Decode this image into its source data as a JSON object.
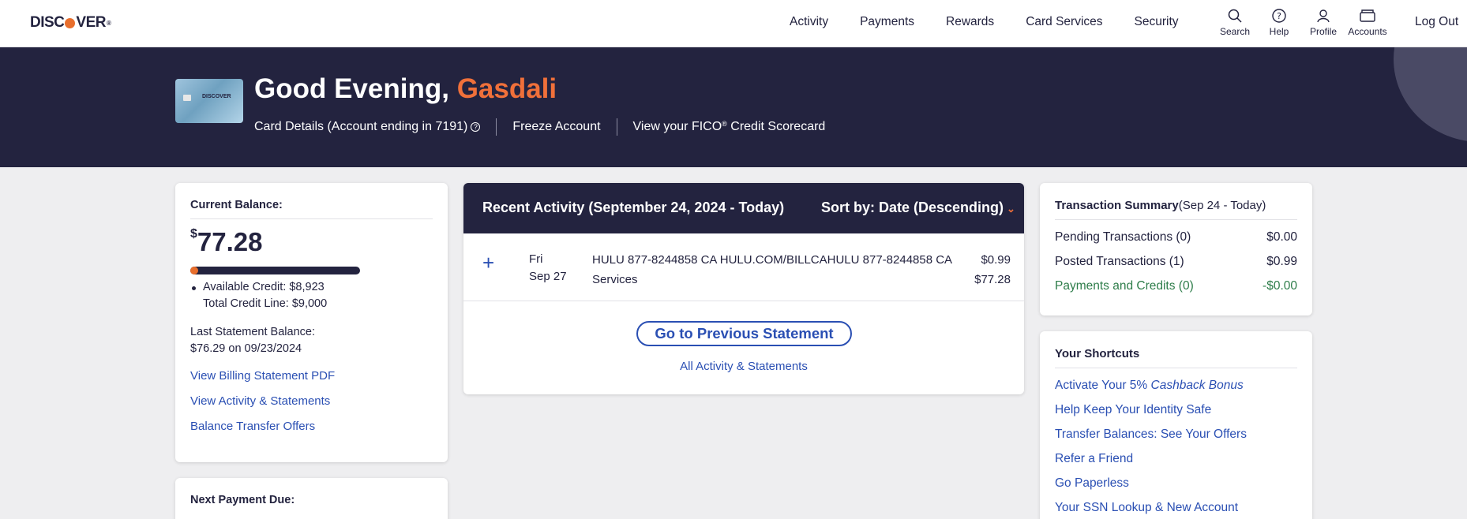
{
  "nav": {
    "logo": "DISCOVER",
    "links": [
      "Activity",
      "Payments",
      "Rewards",
      "Card Services",
      "Security"
    ],
    "icons": [
      {
        "label": "Search",
        "icon": "search-icon"
      },
      {
        "label": "Help",
        "icon": "help-icon"
      },
      {
        "label": "Profile",
        "icon": "profile-icon"
      },
      {
        "label": "Accounts",
        "icon": "accounts-icon"
      }
    ],
    "logout": "Log Out"
  },
  "banner": {
    "greeting": "Good Evening,",
    "name": "Gasdali",
    "card_logo": "DISCOVER",
    "card_details": "Card Details (Account ending in 7191)",
    "freeze": "Freeze Account",
    "fico_prefix": "View your FICO",
    "fico_reg": "®",
    "fico_suffix": "Credit Scorecard"
  },
  "balance": {
    "label": "Current Balance:",
    "currency": "$",
    "amount": "77.28",
    "utilization": 0.0086,
    "available_credit": "Available Credit: $8,923",
    "total_credit_line": "Total Credit Line: $9,000",
    "last_statement_label": "Last Statement Balance:",
    "last_statement_value": "$76.29 on 09/23/2024",
    "links": [
      "View Billing Statement PDF",
      "View Activity & Statements",
      "Balance Transfer Offers"
    ]
  },
  "next_payment": {
    "label": "Next Payment Due:"
  },
  "activity": {
    "title": "Recent Activity (September 24, 2024 - Today)",
    "sort_label": "Sort by: Date (Descending)",
    "transactions": [
      {
        "day": "Fri",
        "date": "Sep 27",
        "description": "HULU 877-8244858 CA HULU.COM/BILLCAHULU 877-8244858 CA Services",
        "amount": "$0.99",
        "balance": "$77.28"
      }
    ],
    "prev_statement": "Go to Previous Statement",
    "all_activity": "All Activity & Statements"
  },
  "summary": {
    "title": "Transaction Summary",
    "range": "(Sep 24 - Today)",
    "rows": [
      {
        "label": "Pending Transactions (0)",
        "value": "$0.00"
      },
      {
        "label": "Posted Transactions (1)",
        "value": "$0.99"
      },
      {
        "label": "Payments and Credits (0)",
        "value": "-$0.00"
      }
    ]
  },
  "shortcuts": {
    "title": "Your Shortcuts",
    "cashback_prefix": "Activate Your 5%",
    "cashback_italic": "Cashback Bonus",
    "items": [
      "Help Keep Your Identity Safe",
      "Transfer Balances: See Your Offers",
      "Refer a Friend",
      "Go Paperless",
      "Your SSN Lookup & New Account"
    ]
  },
  "colors": {
    "navy": "#23233f",
    "accent_orange": "#e86e2c",
    "link_blue": "#2a4fb3",
    "credit_green": "#2e7d4a"
  }
}
